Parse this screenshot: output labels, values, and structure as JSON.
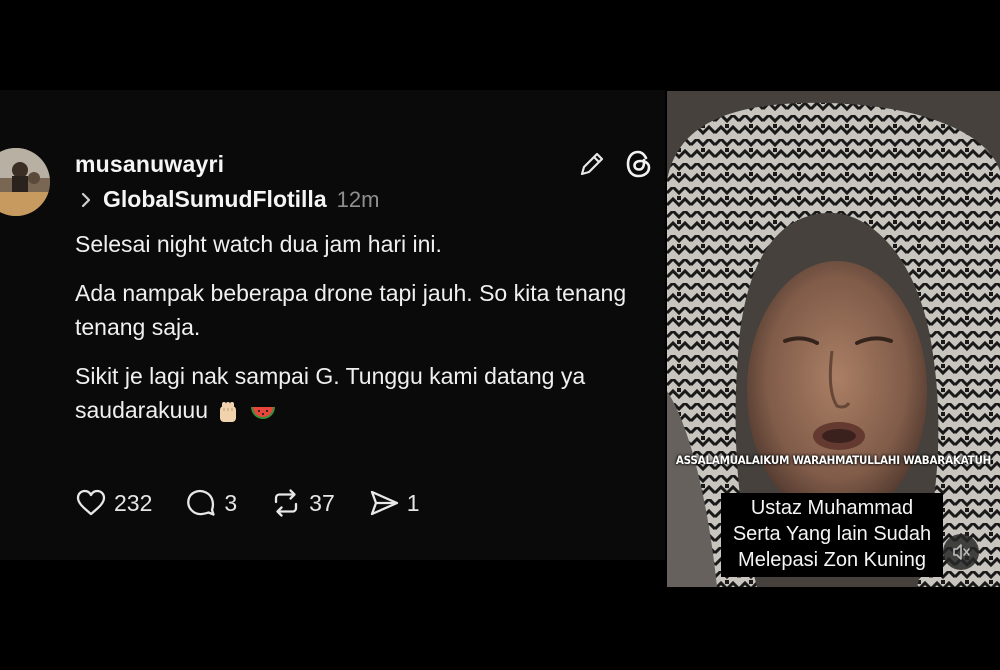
{
  "post": {
    "username": "musanuwayri",
    "community": "GlobalSumudFlotilla",
    "timestamp": "12m",
    "paragraphs": [
      "Selesai night watch dua jam hari ini.",
      "Ada nampak beberapa drone tapi jauh. So kita tenang tenang saja.",
      "Sikit je lagi nak sampai G. Tunggu kami datang ya saudarakuuu"
    ],
    "emojis": [
      "raised-fist-icon",
      "watermelon-icon"
    ],
    "actions": {
      "likes": "232",
      "replies": "3",
      "reposts": "37",
      "shares": "1"
    }
  },
  "video": {
    "greeting_overlay": "ASSALAMUALAIKUM WARAHMATULLAHI WABARAKATUH",
    "caption_lines": [
      "Ustaz Muhammad",
      "Serta Yang lain Sudah",
      "Melepasi Zon Kuning"
    ],
    "mute_icon": "muted-speaker-icon"
  },
  "colors": {
    "background": "#000000",
    "card": "#0a0a0a",
    "text": "#f3f3f3",
    "muted_text": "#8f8f8f"
  }
}
